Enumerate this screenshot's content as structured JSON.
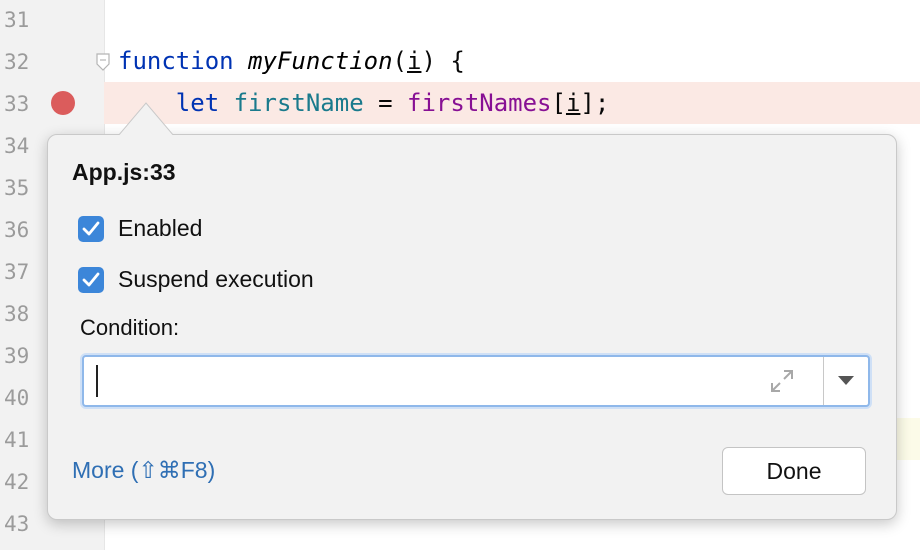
{
  "editor": {
    "line_numbers": [
      "31",
      "32",
      "33",
      "34",
      "35",
      "36",
      "37",
      "38",
      "39",
      "40",
      "41",
      "42",
      "43"
    ],
    "lines": {
      "l32": {
        "keyword": "function",
        "name": "myFunction",
        "param": "i",
        "rest": ") {"
      },
      "l33": {
        "keyword": "let",
        "var": "firstName",
        "eq": " = ",
        "prop": "firstNames",
        "open": "[",
        "idx": "i",
        "close": "];"
      }
    },
    "breakpoint_color": "#db5c5c"
  },
  "popup": {
    "title": "App.js:33",
    "enabled": {
      "label": "Enabled",
      "checked": true
    },
    "suspend": {
      "label": "Suspend execution",
      "checked": true
    },
    "condition_label": "Condition:",
    "condition_value": "",
    "more_link": "More (⇧⌘F8)",
    "done_button": "Done",
    "accent": "#3c86d9",
    "link_color": "#2f6fb4"
  }
}
